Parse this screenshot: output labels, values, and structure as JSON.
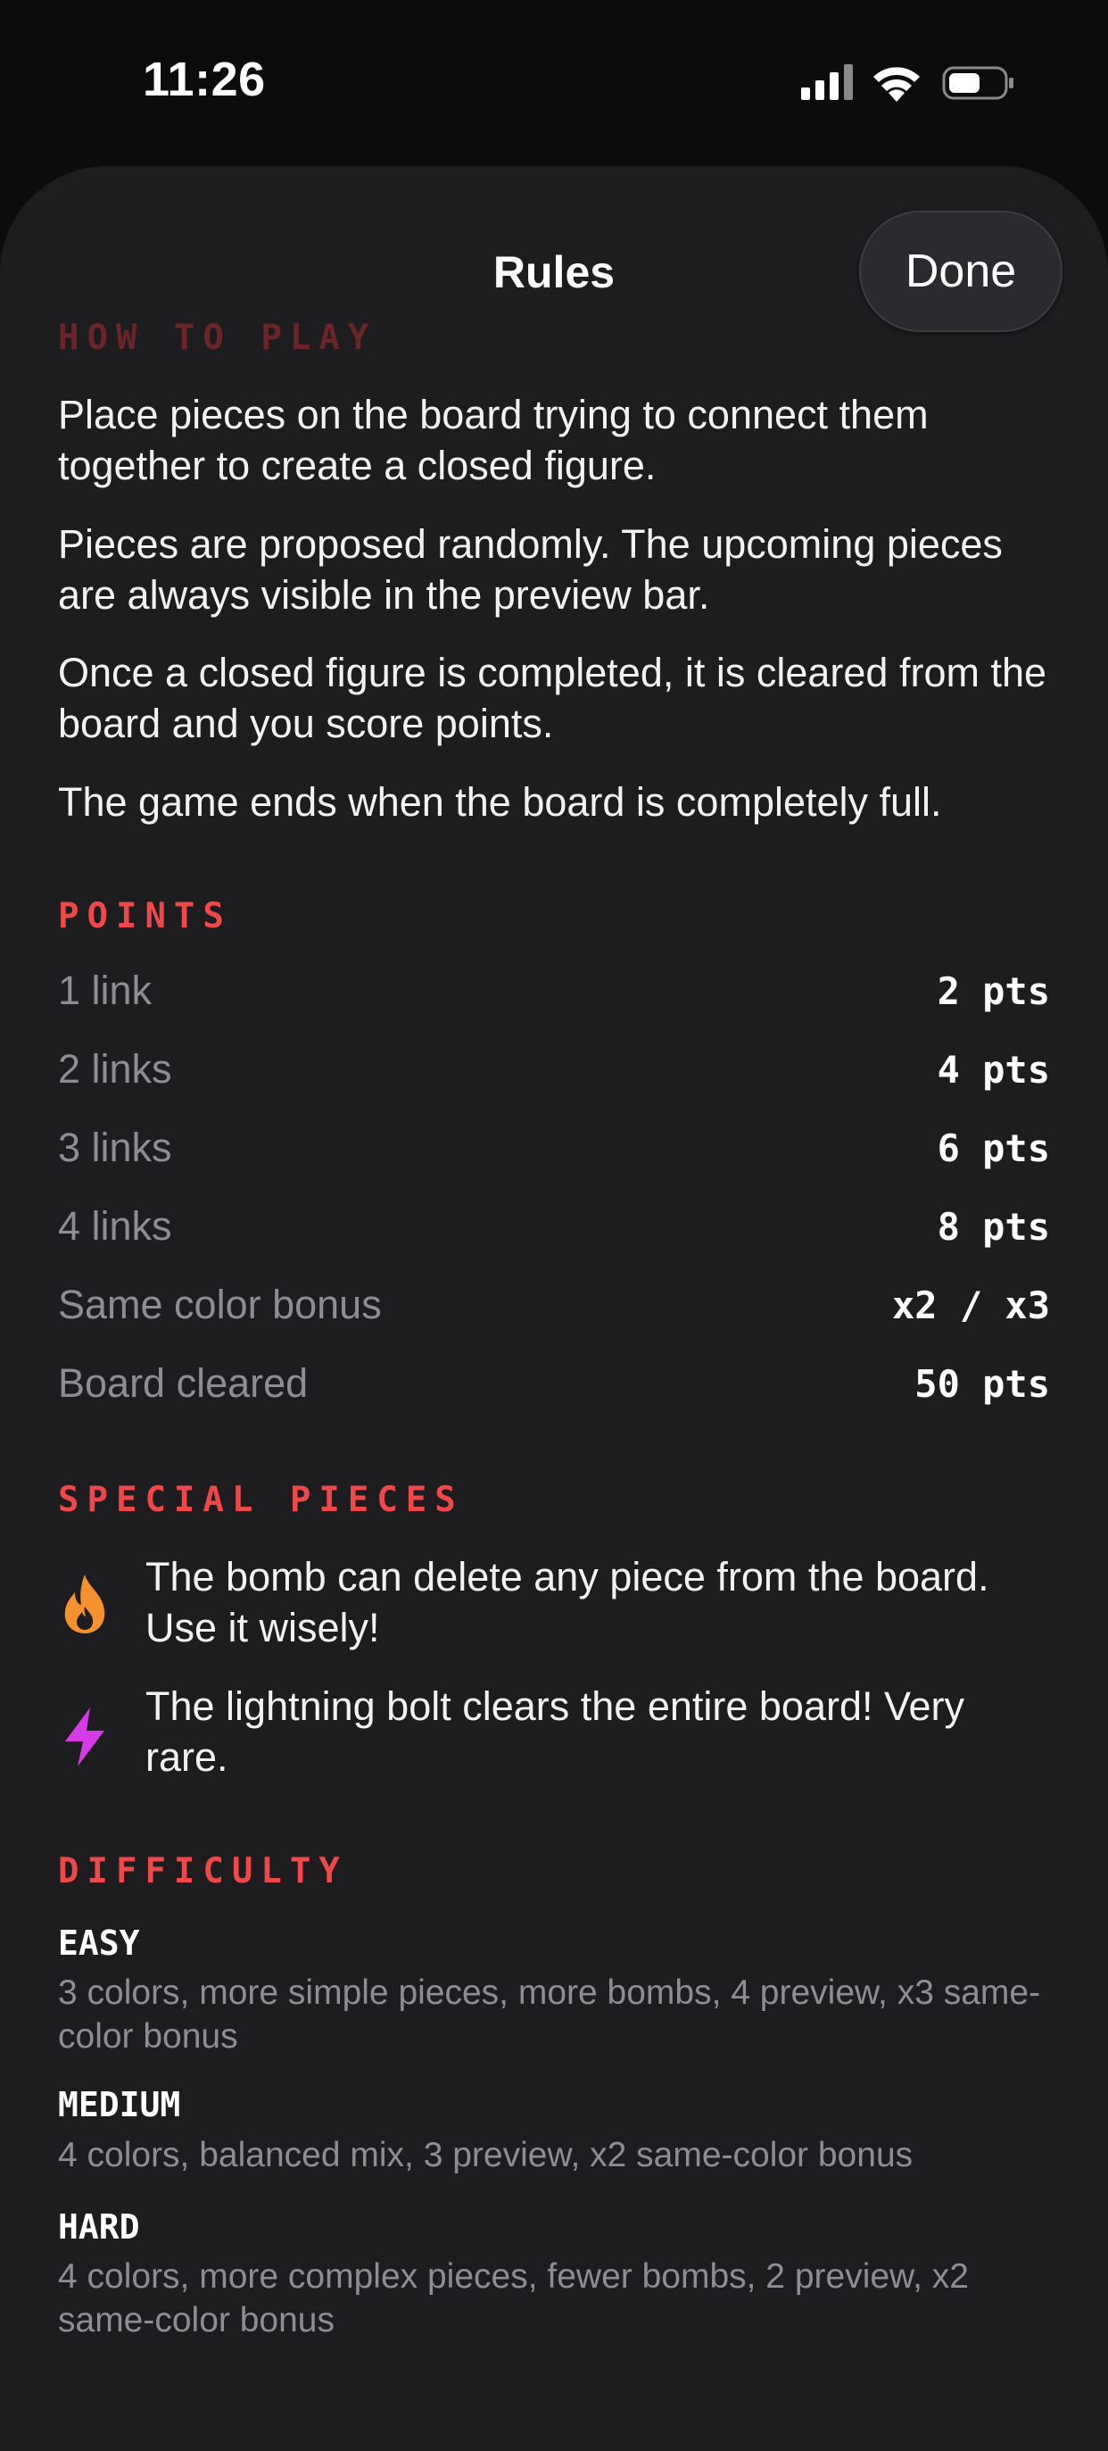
{
  "status_bar": {
    "time": "11:26"
  },
  "sheet": {
    "title": "Rules",
    "done_label": "Done"
  },
  "how_to_play": {
    "header": "HOW TO PLAY",
    "paragraphs": [
      "Place pieces on the board trying to connect them together to create a closed figure.",
      "Pieces are proposed randomly. The upcoming pieces are always visible in the preview bar.",
      "Once a closed figure is completed, it is cleared from the board and you score points.",
      "The game ends when the board is completely full."
    ]
  },
  "points": {
    "header": "POINTS",
    "rows": [
      {
        "label": "1 link",
        "value": "2 pts"
      },
      {
        "label": "2 links",
        "value": "4 pts"
      },
      {
        "label": "3 links",
        "value": "6 pts"
      },
      {
        "label": "4 links",
        "value": "8 pts"
      },
      {
        "label": "Same color bonus",
        "value": "x2 / x3"
      },
      {
        "label": "Board cleared",
        "value": "50 pts"
      }
    ]
  },
  "special_pieces": {
    "header": "SPECIAL PIECES",
    "items": [
      {
        "icon": "flame-icon",
        "color": "#f5922f",
        "text": "The bomb can delete any piece from the board. Use it wisely!"
      },
      {
        "icon": "lightning-bolt-icon",
        "color": "#d63ae6",
        "text": "The lightning bolt clears the entire board! Very rare."
      }
    ]
  },
  "difficulty": {
    "header": "DIFFICULTY",
    "levels": [
      {
        "name": "EASY",
        "description": "3 colors, more simple pieces, more bombs, 4 preview, x3 same-color bonus"
      },
      {
        "name": "MEDIUM",
        "description": "4 colors, balanced mix, 3 preview, x2 same-color bonus"
      },
      {
        "name": "HARD",
        "description": "4 colors, more complex pieces, fewer bombs, 2 preview, x2 same-color bonus"
      }
    ]
  },
  "colors": {
    "accent": "#f04848",
    "sheet_bg": "#1d1d20",
    "muted_text": "#8d8d93"
  }
}
